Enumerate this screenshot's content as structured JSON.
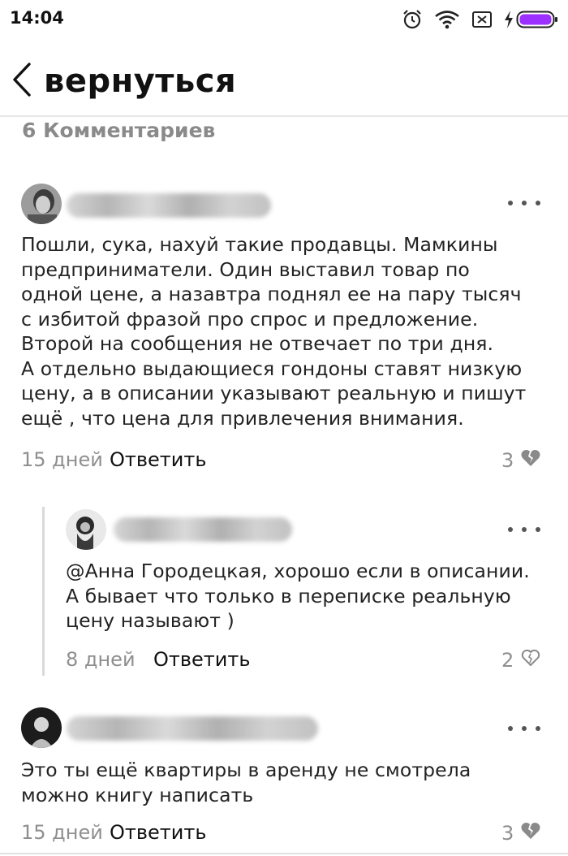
{
  "status_bar": {
    "time": "14:04",
    "icons": [
      "alarm-icon",
      "wifi-icon",
      "no-sim-icon",
      "charging-icon",
      "battery-icon"
    ],
    "battery_color": "#9b30ff"
  },
  "header": {
    "back_label": "вернуться"
  },
  "comments_count": "6 Комментариев",
  "colors": {
    "text": "#222222",
    "muted": "#8f8f8f",
    "divider": "#e6e6e6",
    "broken_heart": "#8a8a8a"
  },
  "comments": [
    {
      "text": "Пошли, сука, нахуй такие продавцы. Мамкины\nпредприниматели. Один выставил товар по\nодной цене, а назавтра поднял ее на пару тысяч\nс избитой фразой про спрос и предложение.\nВторой на сообщения не отвечает по три дня.\nА отдельно выдающиеся гондоны ставят низкую\nцену, а в описании указывают реальную и пишут\nещё , что цена для привлечения внимания.",
      "time": "15 дней",
      "reply_label": "Ответить",
      "likes": "3",
      "like_icon": "broken-heart-icon"
    },
    {
      "text": "@Анна Городецкая, хорошо если в описании.\nА бывает что только в переписке реальную\nцену называют )",
      "time": "8 дней",
      "reply_label": "Ответить",
      "likes": "2",
      "like_icon": "heart-outline-icon"
    },
    {
      "text": "Это ты ещё квартиры в аренду не смотрела\nможно книгу написать",
      "time": "15 дней",
      "reply_label": "Ответить",
      "likes": "3",
      "like_icon": "broken-heart-icon"
    }
  ]
}
